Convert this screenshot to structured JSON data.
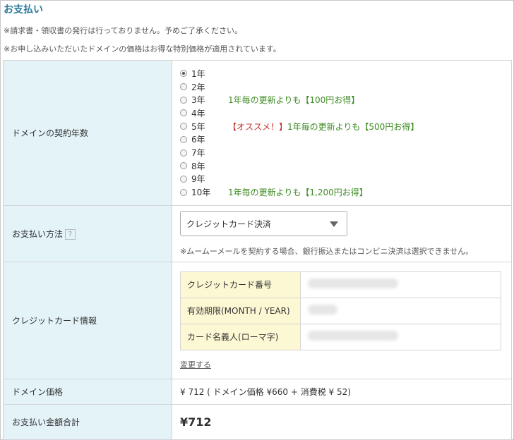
{
  "page": {
    "title": "お支払い",
    "notes": [
      "※請求書・領収書の発行は行っておりません。予めご了承ください。",
      "※お申し込みいただいたドメインの価格はお得な特別価格が適用されています。"
    ]
  },
  "contract": {
    "label": "ドメインの契約年数",
    "selected": "1年",
    "options": [
      {
        "label": "1年",
        "note": "",
        "highlight": ""
      },
      {
        "label": "2年",
        "note": "",
        "highlight": ""
      },
      {
        "label": "3年",
        "note": "1年毎の更新よりも【100円お得】",
        "highlight": ""
      },
      {
        "label": "4年",
        "note": "",
        "highlight": ""
      },
      {
        "label": "5年",
        "note": "1年毎の更新よりも【500円お得】",
        "highlight": "【オススメ！】"
      },
      {
        "label": "6年",
        "note": "",
        "highlight": ""
      },
      {
        "label": "7年",
        "note": "",
        "highlight": ""
      },
      {
        "label": "8年",
        "note": "",
        "highlight": ""
      },
      {
        "label": "9年",
        "note": "",
        "highlight": ""
      },
      {
        "label": "10年",
        "note": "1年毎の更新よりも【1,200円お得】",
        "highlight": ""
      }
    ]
  },
  "payment": {
    "label": "お支払い方法",
    "help_icon": "?",
    "selected": "クレジットカード決済",
    "note": "※ムームーメールを契約する場合、銀行振込またはコンビニ決済は選択できません。"
  },
  "card": {
    "label": "クレジットカード情報",
    "fields": [
      {
        "label": "クレジットカード番号"
      },
      {
        "label": "有効期限(MONTH / YEAR)"
      },
      {
        "label": "カード名義人(ローマ字)"
      }
    ],
    "change_link": "変更する"
  },
  "price": {
    "label": "ドメイン価格",
    "value": "¥ 712 ( ドメイン価格 ¥660 + 消費税 ¥ 52)"
  },
  "total": {
    "label": "お支払い金額合計",
    "value": "¥712"
  },
  "colors": {
    "label_bg": "#e3f3f8",
    "title": "#2b7a9b",
    "note_green": "#3d8b22",
    "recommend_red": "#c0302c",
    "card_label_bg": "#fdf8d4"
  }
}
